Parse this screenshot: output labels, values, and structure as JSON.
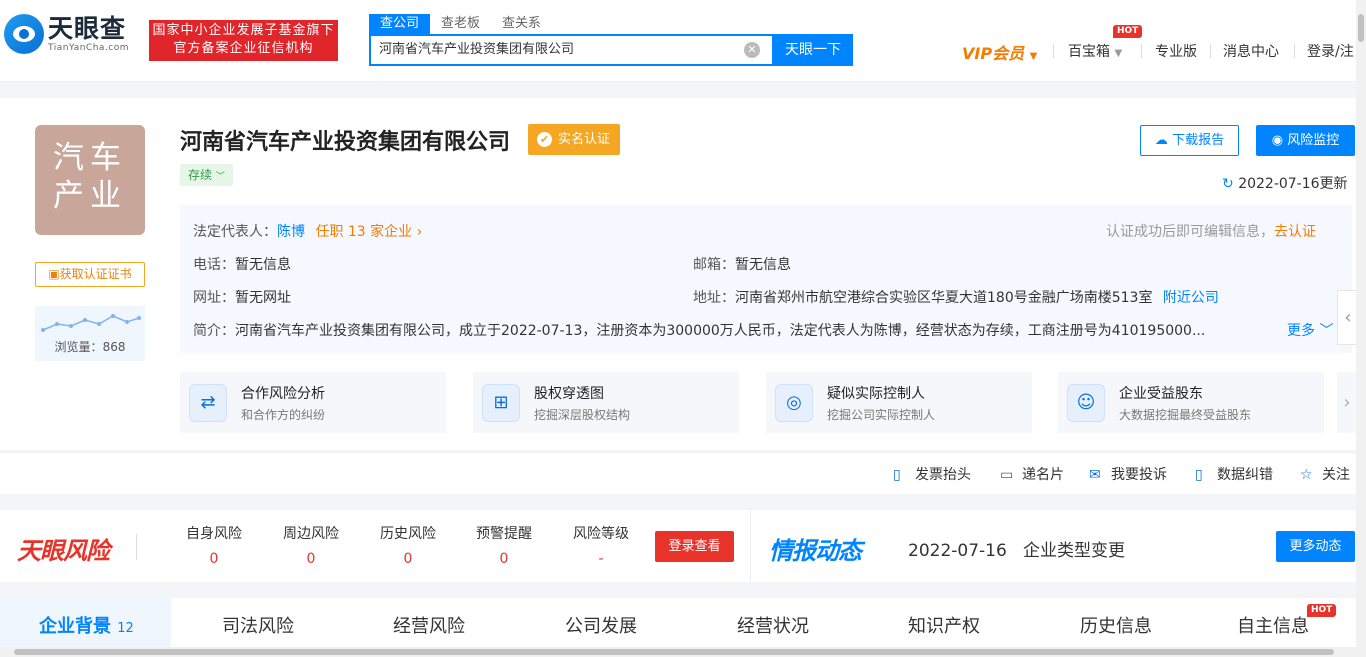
{
  "header": {
    "logo_cn": "天眼查",
    "logo_en": "TianYanCha.com",
    "badge_line1": "国家中小企业发展子基金旗下",
    "badge_line2": "官方备案企业征信机构",
    "search_tabs": [
      "查公司",
      "查老板",
      "查关系"
    ],
    "search_value": "河南省汽车产业投资集团有限公司",
    "search_button": "天眼一下",
    "nav": {
      "vip": "VIP会员",
      "treasure": "百宝箱",
      "hot": "HOT",
      "pro": "专业版",
      "messages": "消息中心",
      "login": "登录/注"
    }
  },
  "company": {
    "avatar_line1": "汽车",
    "avatar_line2": "产业",
    "cert_button": "获取认证证书",
    "views_label": "浏览量",
    "views_count": "868",
    "name": "河南省汽车产业投资集团有限公司",
    "verified": "实名认证",
    "status": "存续",
    "download_button": "下载报告",
    "monitor_button": "风险监控",
    "update_text": "2022-07-16更新",
    "legal_rep_label": "法定代表人：",
    "legal_rep": "陈博",
    "roles": "任职 13 家企业",
    "edit_hint": "认证成功后即可编辑信息，",
    "edit_link": "去认证",
    "phone_label": "电话：",
    "phone": "暂无信息",
    "email_label": "邮箱：",
    "email": "暂无信息",
    "website_label": "网址：",
    "website": "暂无网址",
    "address_label": "地址：",
    "address": "河南省郑州市航空港综合实验区华夏大道180号金融广场南楼513室",
    "nearby": "附近公司",
    "intro_label": "简介：",
    "intro": "河南省汽车产业投资集团有限公司，成立于2022-07-13，注册资本为300000万人民币，法定代表人为陈博，经营状态为存续，工商注册号为410195000...",
    "more": "更多"
  },
  "features": [
    {
      "title": "合作风险分析",
      "sub": "和合作方的纠纷",
      "icon": "handshake-icon"
    },
    {
      "title": "股权穿透图",
      "sub": "挖掘深层股权结构",
      "icon": "org-chart-icon"
    },
    {
      "title": "疑似实际控制人",
      "sub": "挖掘公司实际控制人",
      "icon": "target-icon"
    },
    {
      "title": "企业受益股东",
      "sub": "大数据挖掘最终受益股东",
      "icon": "person-icon"
    }
  ],
  "tools": [
    "发票抬头",
    "递名片",
    "我要投诉",
    "数据纠错",
    "关注"
  ],
  "risk": {
    "logo": "天眼风险",
    "columns": [
      {
        "label": "自身风险",
        "value": "0"
      },
      {
        "label": "周边风险",
        "value": "0"
      },
      {
        "label": "历史风险",
        "value": "0"
      },
      {
        "label": "预警提醒",
        "value": "0"
      },
      {
        "label": "风险等级",
        "value": "-"
      }
    ],
    "login_button": "登录查看"
  },
  "news": {
    "logo": "情报动态",
    "date": "2022-07-16",
    "event": "企业类型变更",
    "more_button": "更多动态"
  },
  "tabs": [
    {
      "label": "企业背景",
      "count": "12"
    },
    {
      "label": "司法风险"
    },
    {
      "label": "经营风险"
    },
    {
      "label": "公司发展"
    },
    {
      "label": "经营状况"
    },
    {
      "label": "知识产权"
    },
    {
      "label": "历史信息"
    },
    {
      "label": "自主信息",
      "hot": "HOT"
    }
  ],
  "colors": {
    "brand_blue": "#0084ff",
    "risk_red": "#e8332b",
    "vip_orange": "#f57c00"
  }
}
